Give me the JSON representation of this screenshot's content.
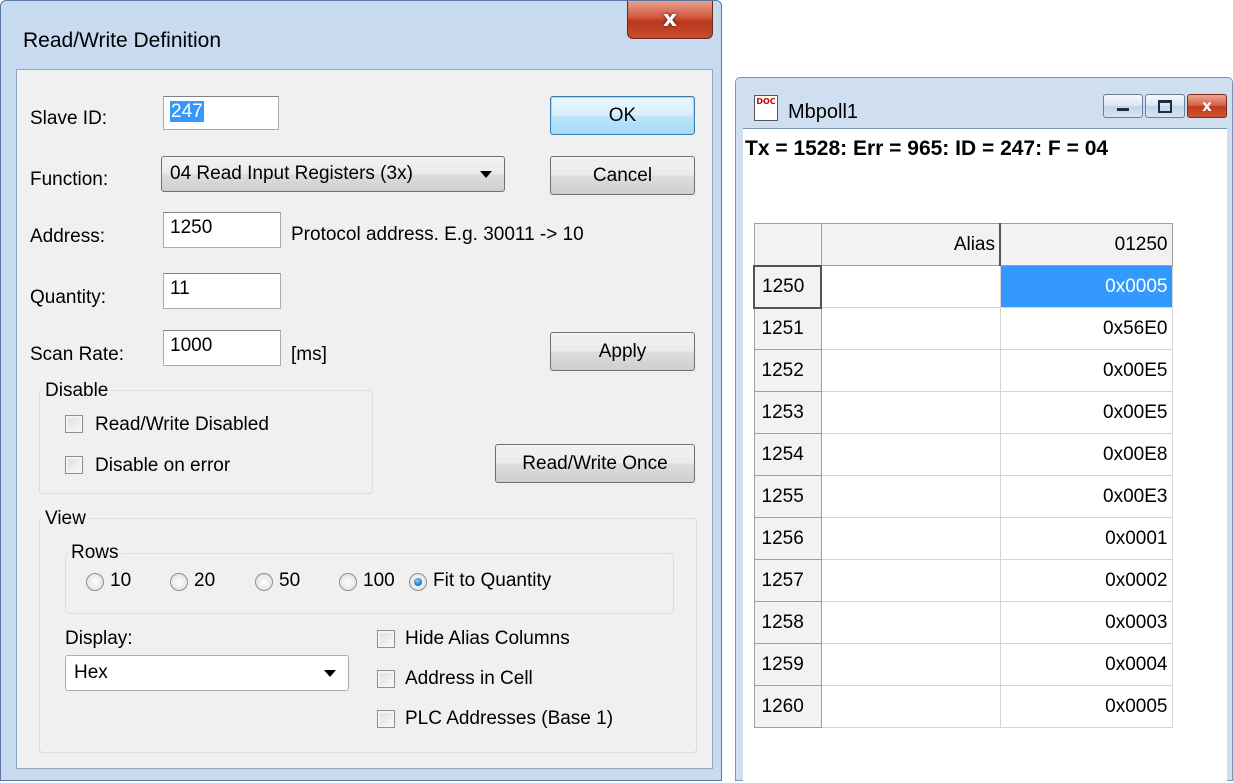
{
  "dialog": {
    "title": "Read/Write Definition",
    "close_glyph": "x",
    "slave_id": {
      "label": "Slave ID:",
      "value": "247"
    },
    "function": {
      "label": "Function:",
      "value": "04 Read Input Registers (3x)"
    },
    "address": {
      "label": "Address:",
      "value": "1250",
      "hint": "Protocol address. E.g. 30011 -> 10"
    },
    "quantity": {
      "label": "Quantity:",
      "value": "11"
    },
    "scan_rate": {
      "label": "Scan Rate:",
      "value": "1000",
      "unit": "[ms]"
    },
    "buttons": {
      "ok": "OK",
      "cancel": "Cancel",
      "apply": "Apply",
      "rw_once": "Read/Write Once"
    },
    "disable_group": {
      "title": "Disable",
      "rw_disabled": {
        "label": "Read/Write Disabled",
        "checked": false
      },
      "disable_on_error": {
        "label": "Disable on error",
        "checked": false
      }
    },
    "view_group": {
      "title": "View",
      "rows": {
        "title": "Rows",
        "options": [
          "10",
          "20",
          "50",
          "100",
          "Fit to Quantity"
        ],
        "selected": "Fit to Quantity"
      },
      "display": {
        "label": "Display:",
        "value": "Hex"
      },
      "hide_alias": {
        "label": "Hide Alias Columns",
        "checked": false
      },
      "address_in_cell": {
        "label": "Address in Cell",
        "checked": false
      },
      "plc_addresses": {
        "label": "PLC Addresses (Base 1)",
        "checked": false
      }
    }
  },
  "mbpoll": {
    "title": "Mbpoll1",
    "icon_text": "DOC",
    "status": "Tx = 1528: Err = 965: ID = 247: F = 04",
    "columns": {
      "alias": "Alias",
      "value": "01250"
    },
    "rows": [
      {
        "addr": "1250",
        "alias": "",
        "value": "0x0005"
      },
      {
        "addr": "1251",
        "alias": "",
        "value": "0x56E0"
      },
      {
        "addr": "1252",
        "alias": "",
        "value": "0x00E5"
      },
      {
        "addr": "1253",
        "alias": "",
        "value": "0x00E5"
      },
      {
        "addr": "1254",
        "alias": "",
        "value": "0x00E8"
      },
      {
        "addr": "1255",
        "alias": "",
        "value": "0x00E3"
      },
      {
        "addr": "1256",
        "alias": "",
        "value": "0x0001"
      },
      {
        "addr": "1257",
        "alias": "",
        "value": "0x0002"
      },
      {
        "addr": "1258",
        "alias": "",
        "value": "0x0003"
      },
      {
        "addr": "1259",
        "alias": "",
        "value": "0x0004"
      },
      {
        "addr": "1260",
        "alias": "",
        "value": "0x0005"
      }
    ]
  }
}
